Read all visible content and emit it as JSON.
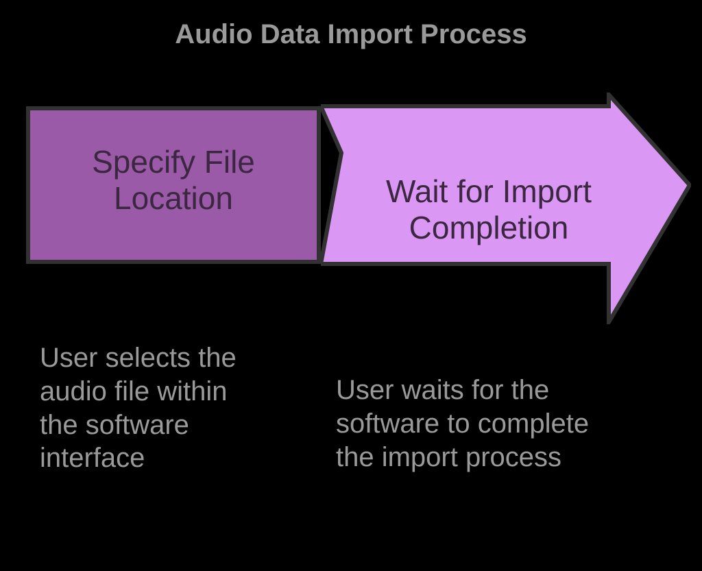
{
  "title": "Audio Data Import Process",
  "steps": [
    {
      "label": "Specify File Location",
      "description": "User selects the audio file within the software interface"
    },
    {
      "label": "Wait for Import Completion",
      "description": "User waits for the software to complete the import process"
    }
  ],
  "colors": {
    "step1_fill": "#9a5aa8",
    "step2_fill": "#da97f3",
    "stroke": "#323232",
    "text_dark": "#3b2840",
    "text_light": "#9a9a9a",
    "background": "#000000"
  }
}
